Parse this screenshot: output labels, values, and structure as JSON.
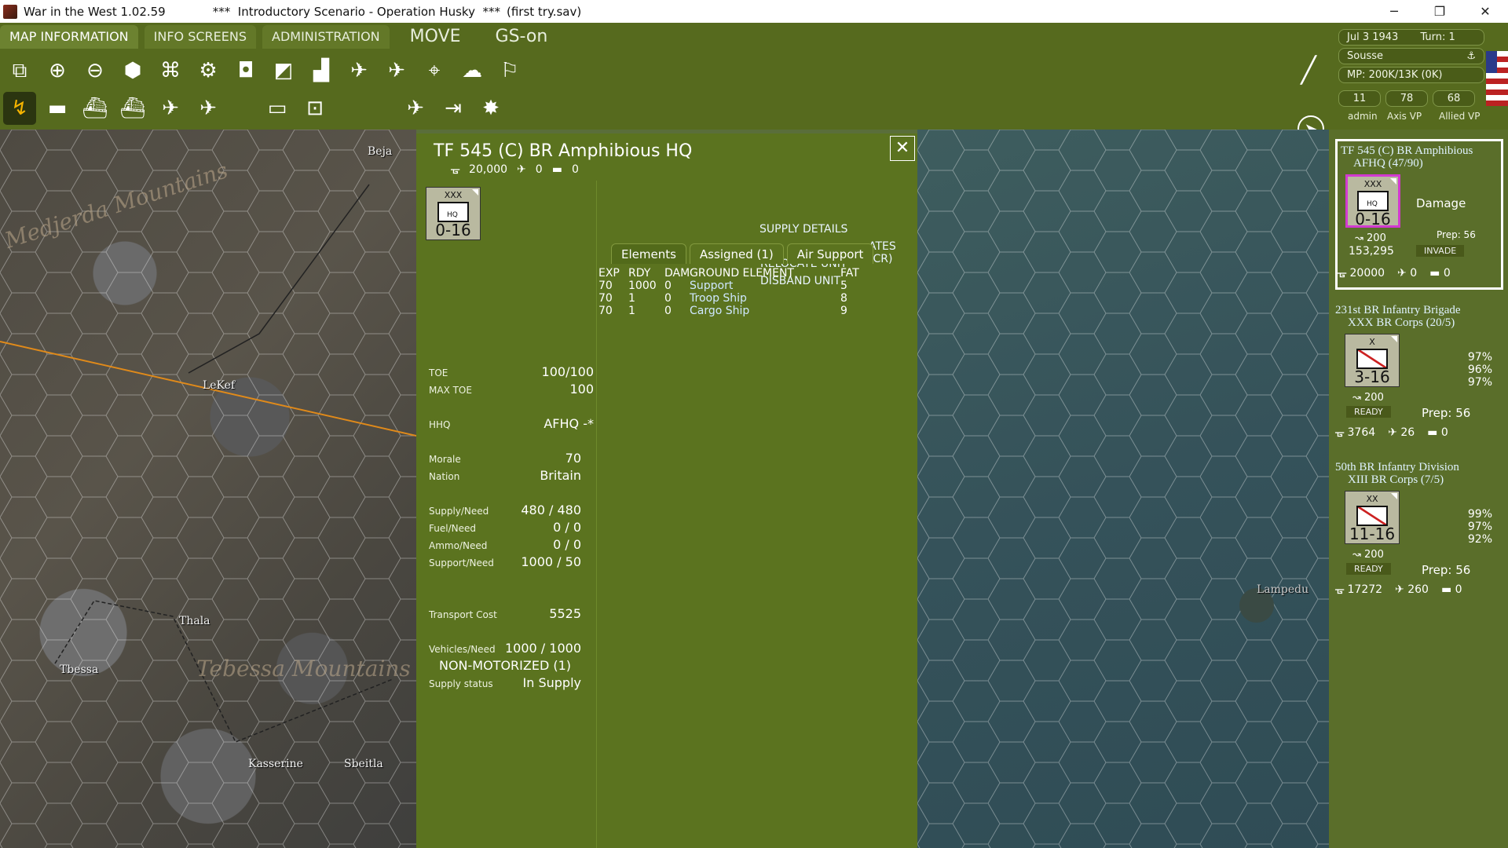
{
  "window": {
    "title": "War in the West 1.02.59",
    "scenario": "***  Introductory Scenario - Operation Husky  ***",
    "save": "(first try.sav)",
    "min": "─",
    "max": "❐",
    "close": "✕"
  },
  "menu": {
    "tabs": [
      "MAP INFORMATION",
      "INFO SCREENS",
      "ADMINISTRATION"
    ],
    "move": "MOVE",
    "gs": "GS-on"
  },
  "topright": {
    "date": "Jul 3 1943",
    "turn": "Turn: 1",
    "location": "Sousse",
    "anchor": "⚓",
    "mp": "MP: 200K/13K (0K)",
    "admin_val": "11",
    "axis_val": "78",
    "allied_val": "68",
    "admin_lbl": "admin",
    "axis_lbl": "Axis VP",
    "allied_lbl": "Allied VP"
  },
  "map": {
    "labels": {
      "beja": "Beja",
      "lekef": "LeKef",
      "thala": "Thala",
      "tbessa": "Tbessa",
      "kasserine": "Kasserine",
      "sbeitla": "Sbeitla",
      "lampedusa": "Lampedu"
    },
    "mountains": [
      "Tebessa Mountains",
      "Medjerda Mountains"
    ]
  },
  "panel": {
    "title": "TF 545 (C) BR Amphibious HQ",
    "men": "20,000",
    "planes": "0",
    "tanks": "0",
    "counter": {
      "size": "XXX",
      "type": "HQ",
      "strength": "0-16"
    },
    "supply_details": "SUPPLY DETAILS",
    "relocate": "RELOCATE UNIT",
    "disband": "DISBAND UNIT",
    "ates": "ATES (CR)",
    "tabs": [
      "Elements",
      "Assigned (1)",
      "Air Support"
    ],
    "headers": [
      "EXP",
      "RDY",
      "DAM",
      "GROUND ELEMENT",
      "FAT"
    ],
    "rows": [
      [
        "70",
        "1000",
        "0",
        "Support",
        "5"
      ],
      [
        "70",
        "1",
        "0",
        "Troop Ship",
        "8"
      ],
      [
        "70",
        "1",
        "0",
        "Cargo Ship",
        "9"
      ]
    ],
    "stats": {
      "toe_k": "TOE",
      "toe_v": "100/100",
      "maxtoe_k": "MAX TOE",
      "maxtoe_v": "100",
      "hhq_k": "HHQ",
      "hhq_v": "AFHQ -*",
      "morale_k": "Morale",
      "morale_v": "70",
      "nation_k": "Nation",
      "nation_v": "Britain",
      "supply_k": "Supply/Need",
      "supply_v": "480 / 480",
      "fuel_k": "Fuel/Need",
      "fuel_v": "0 / 0",
      "ammo_k": "Ammo/Need",
      "ammo_v": "0 / 0",
      "support_k": "Support/Need",
      "support_v": "1000 / 50",
      "transport_k": "Transport Cost",
      "transport_v": "5525",
      "vehicles_k": "Vehicles/Need",
      "vehicles_v": "1000 / 1000",
      "motor": "NON-MOTORIZED (1)",
      "status_k": "Supply status",
      "status_v": "In Supply"
    }
  },
  "sidebar": {
    "units": [
      {
        "name1": "TF 545 (C) BR Amphibious",
        "name2": "AFHQ (47/90)",
        "size": "XXX",
        "type": "HQ",
        "str": "0-16",
        "mp": "200",
        "extra": "153,295",
        "damage": "Damage",
        "prep": "Prep: 56",
        "status": "INVADE",
        "men": "20000",
        "planes": "0",
        "tanks": "0"
      },
      {
        "name1": "231st BR Infantry Brigade",
        "name2": "XXX BR Corps (20/5)",
        "size": "X",
        "str": "3-16",
        "mp": "200",
        "status": "READY",
        "prep": "Prep: 56",
        "p1": "97%",
        "p2": "96%",
        "p3": "97%",
        "men": "3764",
        "planes": "26",
        "tanks": "0"
      },
      {
        "name1": "50th BR Infantry Division",
        "name2": "XIII BR Corps (7/5)",
        "size": "XX",
        "str": "11-16",
        "mp": "200",
        "status": "READY",
        "prep": "Prep: 56",
        "p1": "99%",
        "p2": "97%",
        "p3": "92%",
        "men": "17272",
        "planes": "260",
        "tanks": "0"
      }
    ]
  }
}
